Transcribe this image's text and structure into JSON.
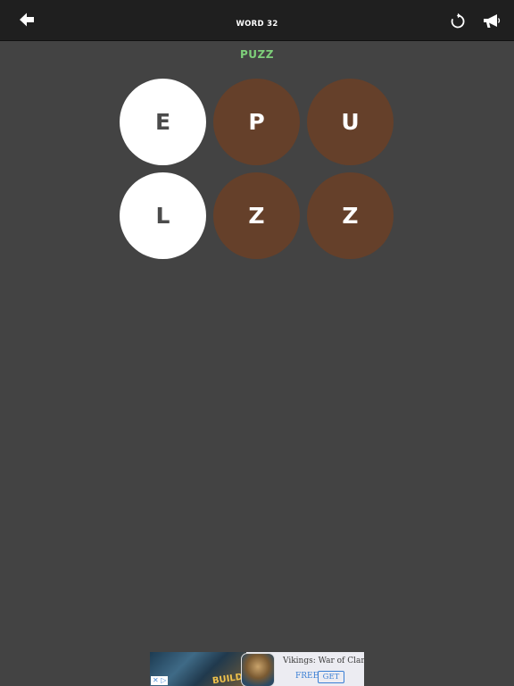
{
  "header": {
    "title": "WORD 32",
    "back_icon": "arrow-left-icon",
    "restart_icon": "restart-icon",
    "hint_icon": "megaphone-icon"
  },
  "answer": {
    "text": "PUZZ",
    "color": "#7ecf7a"
  },
  "tiles": [
    {
      "letter": "E",
      "state": "used"
    },
    {
      "letter": "P",
      "state": "available"
    },
    {
      "letter": "U",
      "state": "available"
    },
    {
      "letter": "L",
      "state": "used"
    },
    {
      "letter": "Z",
      "state": "available"
    },
    {
      "letter": "Z",
      "state": "available"
    }
  ],
  "colors": {
    "background": "#434343",
    "topbar": "#1f1f1f",
    "tile_used": "#ffffff",
    "tile_available": "#65402a"
  },
  "ad": {
    "app_name": "Vikings: War of Clans",
    "price": "FREE",
    "cta": "GET",
    "art_text": "BUILD",
    "close_icon": "ad-close-icon"
  }
}
